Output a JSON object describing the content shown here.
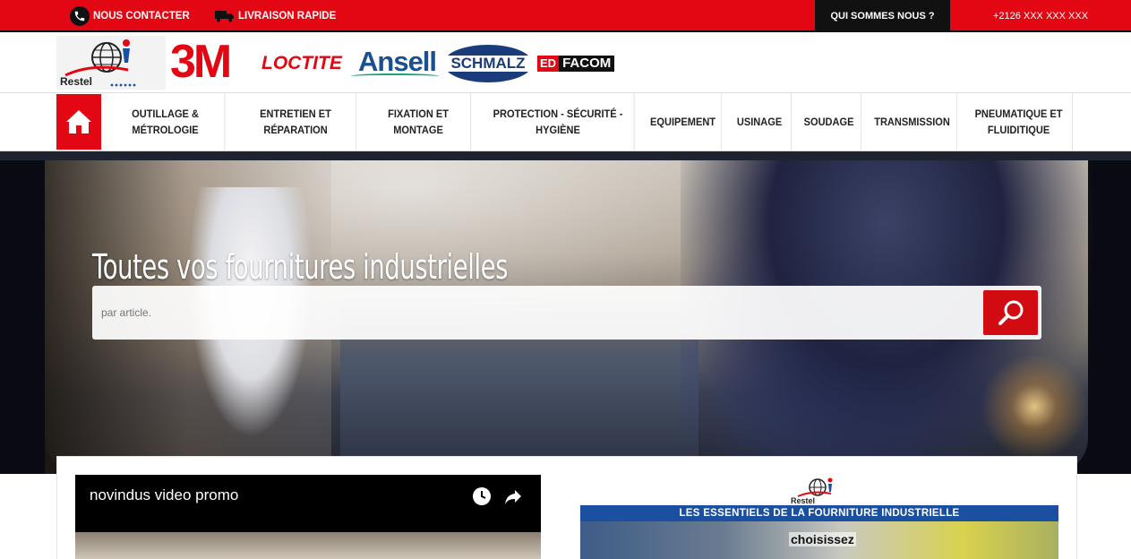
{
  "topbar": {
    "contact_label": "NOUS CONTACTER",
    "delivery_label": "LIVRAISON RAPIDE",
    "about_label": "QUI SOMMES NOUS ?",
    "phone_label": "+2126 XXX XXX XXX",
    "accent_color": "#e30613"
  },
  "brands": {
    "restel": "Restel",
    "brand_3m": "3M",
    "loctite": "LOCTITE",
    "ansell": "Ansell",
    "schmalz": "SCHMALZ",
    "facom_prefix": "ED",
    "facom": "FACOM"
  },
  "nav": {
    "home_icon": "home-icon",
    "items": [
      {
        "line1": "OUTILLAGE &",
        "line2": "MÉTROLOGIE"
      },
      {
        "line1": "ENTRETIEN ET",
        "line2": "RÉPARATION"
      },
      {
        "line1": "FIXATION ET",
        "line2": "MONTAGE"
      },
      {
        "line1": "PROTECTION - SÉCURITÉ -",
        "line2": "HYGIÈNE"
      },
      {
        "line1": "EQUIPEMENT",
        "line2": ""
      },
      {
        "line1": "USINAGE",
        "line2": ""
      },
      {
        "line1": "SOUDAGE",
        "line2": ""
      },
      {
        "line1": "TRANSMISSION",
        "line2": ""
      },
      {
        "line1": "PNEUMATIQUE ET",
        "line2": "FLUIDITIQUE"
      }
    ]
  },
  "hero": {
    "headline": "Toutes vos fournitures industrielles",
    "search_placeholder": "par article.",
    "search_icon": "search-icon"
  },
  "video": {
    "title": "novindus video promo",
    "icons": [
      "clock-icon",
      "share-icon"
    ]
  },
  "promo": {
    "logo_name": "Restel",
    "banner_text": "LES ESSENTIELS DE LA FOURNITURE INDUSTRIELLE",
    "choose_text": "choisissez"
  }
}
